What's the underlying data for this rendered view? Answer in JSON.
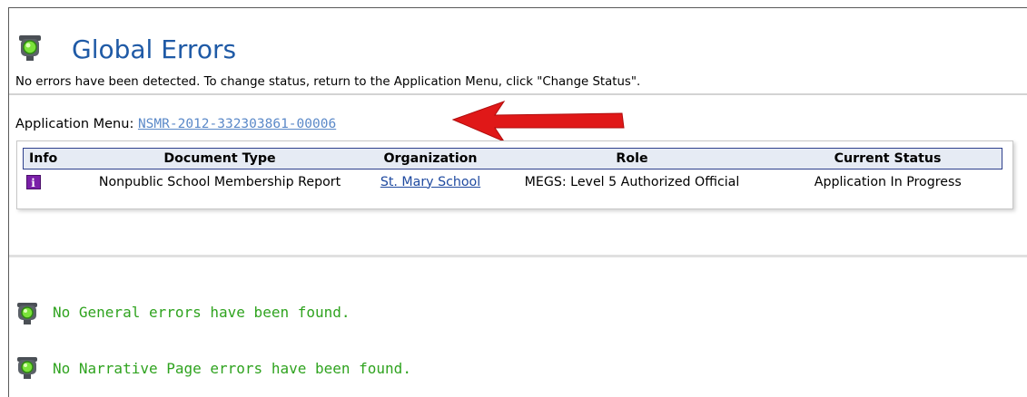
{
  "header": {
    "title": "Global Errors",
    "icon": "traffic-light-icon",
    "description": "No errors have been detected. To change status, return to the Application Menu, click \"Change Status\"."
  },
  "app_menu": {
    "label": "Application Menu:",
    "link_text": "NSMR-2012-332303861-00006"
  },
  "table": {
    "columns": [
      "Info",
      "Document Type",
      "Organization",
      "Role",
      "Current Status"
    ],
    "rows": [
      {
        "info_icon": "info-icon",
        "document_type": "Nonpublic School Membership Report",
        "organization": "St. Mary School",
        "role": "MEGS: Level 5 Authorized Official",
        "current_status": "Application In Progress"
      }
    ]
  },
  "messages": {
    "general": "No General errors have been found.",
    "narrative": "No Narrative Page errors have been found."
  },
  "colors": {
    "title": "#1f5aa6",
    "link": "#5b89c8",
    "success": "#2fa31f",
    "arrow": "#e01818",
    "info_icon": "#7a1fa8"
  }
}
